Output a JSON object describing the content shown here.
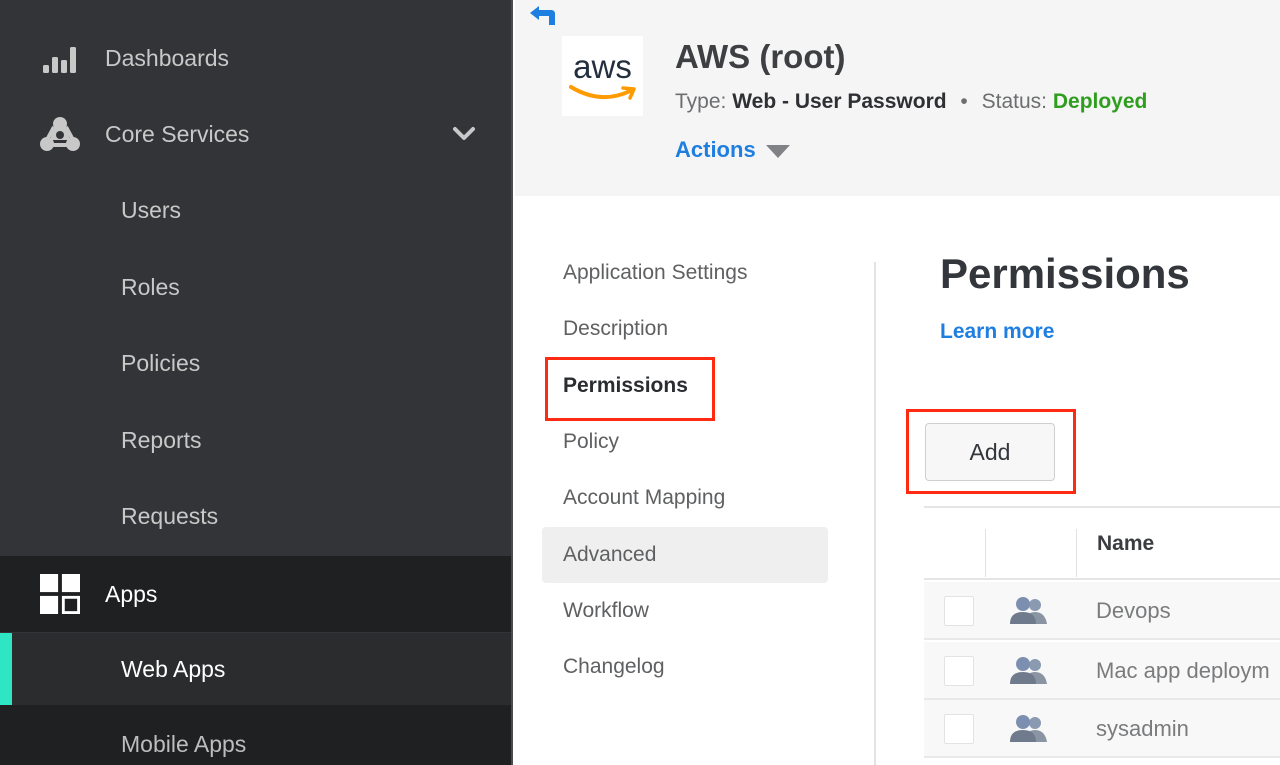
{
  "sidebar": {
    "items": [
      {
        "label": "Dashboards",
        "icon": "bar-chart-icon"
      },
      {
        "label": "Core Services",
        "icon": "core-services-icon",
        "expanded": true
      },
      {
        "label": "Users"
      },
      {
        "label": "Roles"
      },
      {
        "label": "Policies"
      },
      {
        "label": "Reports"
      },
      {
        "label": "Requests"
      },
      {
        "label": "Apps",
        "icon": "apps-grid-icon"
      },
      {
        "label": "Web Apps",
        "active": true
      },
      {
        "label": "Mobile Apps"
      }
    ],
    "active_accent": "#2ee6c4"
  },
  "header": {
    "logo_text": "aws",
    "title": "AWS (root)",
    "type_label": "Type:",
    "type_value": "Web - User Password",
    "separator": "•",
    "status_label": "Status:",
    "status_value": "Deployed",
    "status_color": "#2f9e1f",
    "actions_label": "Actions"
  },
  "subnav": {
    "items": [
      {
        "label": "Application Settings"
      },
      {
        "label": "Description"
      },
      {
        "label": "Permissions",
        "selected": true
      },
      {
        "label": "Policy"
      },
      {
        "label": "Account Mapping"
      },
      {
        "label": "Advanced",
        "hovered": true
      },
      {
        "label": "Workflow"
      },
      {
        "label": "Changelog"
      }
    ]
  },
  "main": {
    "title": "Permissions",
    "learn_more": "Learn more",
    "add_label": "Add",
    "table": {
      "columns": [
        "",
        "",
        "Name"
      ],
      "rows": [
        {
          "name": "Devops",
          "icon": "group-icon"
        },
        {
          "name": "Mac app deploym",
          "icon": "group-icon"
        },
        {
          "name": "sysadmin",
          "icon": "group-icon"
        }
      ]
    }
  },
  "colors": {
    "link": "#1f7fe0",
    "highlight": "#ff2a12"
  }
}
